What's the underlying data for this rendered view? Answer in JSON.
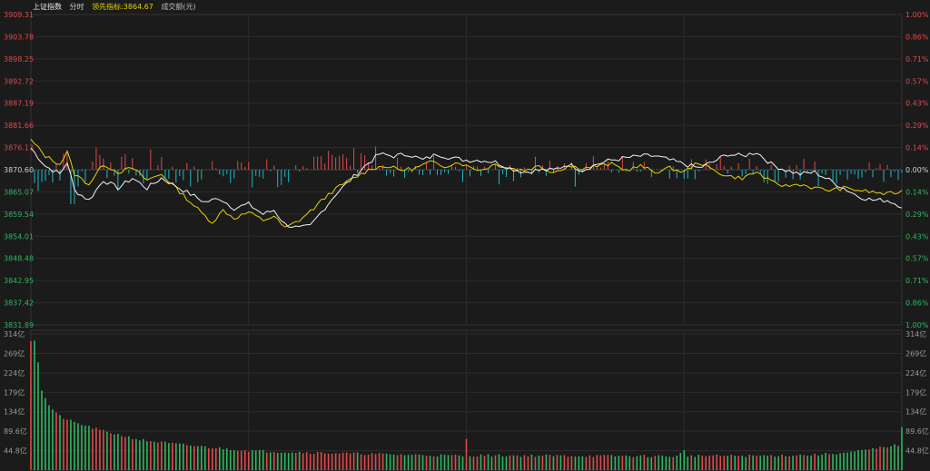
{
  "header": {
    "index_name": "上证指数",
    "period": "分时",
    "leading_label": "领先指标:",
    "leading_value": "3864.67",
    "volume_label": "成交额(元)"
  },
  "colors": {
    "up": "#e04a4a",
    "down": "#22b8c9",
    "price_line": "#f2f2f2",
    "lead_line": "#e6d200",
    "vol_up": "#e04a4a",
    "vol_down": "#2fb75e",
    "neutral": "#d0d0d0"
  },
  "chart_data": [
    {
      "type": "line",
      "title": "",
      "prev_close": 3870.6,
      "ylim": [
        3831.89,
        3909.31
      ],
      "y_ticks_left": [
        "3909.31",
        "3903.78",
        "3898.25",
        "3892.72",
        "3887.19",
        "3881.66",
        "3876.13",
        "3870.60",
        "3865.07",
        "3859.54",
        "3854.01",
        "3848.48",
        "3842.95",
        "3837.42",
        "3831.89"
      ],
      "y_ticks_right": [
        "1.00%",
        "0.86%",
        "0.71%",
        "0.57%",
        "0.43%",
        "0.29%",
        "0.14%",
        "0.00%",
        "0.14%",
        "0.29%",
        "0.43%",
        "0.57%",
        "0.71%",
        "0.86%",
        "1.00%"
      ],
      "grid": true,
      "x_count": 241,
      "series": [
        {
          "role": "price",
          "keys": [
            [
              0,
              3876.0
            ],
            [
              4,
              3871.5
            ],
            [
              8,
              3869.5
            ],
            [
              10,
              3872.5
            ],
            [
              12,
              3865.5
            ],
            [
              16,
              3863.0
            ],
            [
              20,
              3868.0
            ],
            [
              24,
              3866.0
            ],
            [
              28,
              3868.5
            ],
            [
              32,
              3866.0
            ],
            [
              36,
              3868.5
            ],
            [
              40,
              3866.5
            ],
            [
              44,
              3864.5
            ],
            [
              48,
              3862.5
            ],
            [
              52,
              3863.5
            ],
            [
              56,
              3861.0
            ],
            [
              60,
              3862.0
            ],
            [
              64,
              3859.5
            ],
            [
              67,
              3860.5
            ],
            [
              70,
              3857.0
            ],
            [
              74,
              3856.0
            ],
            [
              77,
              3856.5
            ],
            [
              80,
              3860.0
            ],
            [
              84,
              3864.5
            ],
            [
              88,
              3868.0
            ],
            [
              92,
              3871.5
            ],
            [
              96,
              3874.5
            ],
            [
              100,
              3874.0
            ],
            [
              104,
              3874.5
            ],
            [
              108,
              3873.0
            ],
            [
              112,
              3874.5
            ],
            [
              116,
              3873.5
            ],
            [
              120,
              3873.0
            ],
            [
              124,
              3873.0
            ],
            [
              128,
              3872.5
            ],
            [
              132,
              3871.0
            ],
            [
              136,
              3870.0
            ],
            [
              140,
              3870.5
            ],
            [
              144,
              3870.5
            ],
            [
              148,
              3872.0
            ],
            [
              152,
              3870.5
            ],
            [
              156,
              3872.0
            ],
            [
              160,
              3873.0
            ],
            [
              164,
              3873.5
            ],
            [
              168,
              3874.0
            ],
            [
              172,
              3874.0
            ],
            [
              176,
              3873.0
            ],
            [
              180,
              3872.0
            ],
            [
              184,
              3871.0
            ],
            [
              188,
              3872.5
            ],
            [
              192,
              3874.5
            ],
            [
              196,
              3874.0
            ],
            [
              200,
              3875.0
            ],
            [
              204,
              3872.0
            ],
            [
              208,
              3870.5
            ],
            [
              212,
              3869.5
            ],
            [
              216,
              3870.0
            ],
            [
              220,
              3868.0
            ],
            [
              224,
              3866.0
            ],
            [
              228,
              3864.0
            ],
            [
              232,
              3863.0
            ],
            [
              236,
              3863.0
            ],
            [
              240,
              3861.5
            ]
          ]
        },
        {
          "role": "leading",
          "keys": [
            [
              0,
              3878.0
            ],
            [
              4,
              3874.0
            ],
            [
              8,
              3872.0
            ],
            [
              10,
              3875.0
            ],
            [
              12,
              3869.5
            ],
            [
              16,
              3867.0
            ],
            [
              20,
              3872.0
            ],
            [
              24,
              3870.0
            ],
            [
              28,
              3871.0
            ],
            [
              32,
              3868.0
            ],
            [
              36,
              3869.5
            ],
            [
              40,
              3866.0
            ],
            [
              44,
              3862.5
            ],
            [
              48,
              3859.0
            ],
            [
              50,
              3857.5
            ],
            [
              53,
              3860.5
            ],
            [
              56,
              3858.5
            ],
            [
              60,
              3860.0
            ],
            [
              64,
              3858.0
            ],
            [
              67,
              3859.0
            ],
            [
              70,
              3856.0
            ],
            [
              74,
              3858.0
            ],
            [
              78,
              3861.0
            ],
            [
              82,
              3864.5
            ],
            [
              86,
              3867.0
            ],
            [
              90,
              3869.0
            ],
            [
              94,
              3871.0
            ],
            [
              98,
              3871.5
            ],
            [
              102,
              3870.5
            ],
            [
              106,
              3871.0
            ],
            [
              110,
              3872.5
            ],
            [
              114,
              3871.5
            ],
            [
              118,
              3872.5
            ],
            [
              120,
              3871.5
            ],
            [
              124,
              3870.5
            ],
            [
              128,
              3872.0
            ],
            [
              132,
              3871.0
            ],
            [
              136,
              3870.5
            ],
            [
              140,
              3871.5
            ],
            [
              144,
              3870.0
            ],
            [
              148,
              3871.5
            ],
            [
              152,
              3871.0
            ],
            [
              156,
              3871.5
            ],
            [
              160,
              3872.0
            ],
            [
              164,
              3870.5
            ],
            [
              168,
              3871.5
            ],
            [
              172,
              3870.0
            ],
            [
              176,
              3871.0
            ],
            [
              180,
              3870.0
            ],
            [
              184,
              3872.5
            ],
            [
              188,
              3870.5
            ],
            [
              192,
              3869.0
            ],
            [
              196,
              3868.5
            ],
            [
              200,
              3870.0
            ],
            [
              204,
              3867.5
            ],
            [
              208,
              3866.5
            ],
            [
              212,
              3867.0
            ],
            [
              216,
              3866.0
            ],
            [
              220,
              3865.5
            ],
            [
              224,
              3866.0
            ],
            [
              228,
              3865.5
            ],
            [
              232,
              3865.0
            ],
            [
              236,
              3864.5
            ],
            [
              240,
              3865.2
            ]
          ]
        }
      ]
    },
    {
      "type": "bar",
      "title": "",
      "ylim": [
        0,
        314
      ],
      "y_ticks": [
        "314亿",
        "269亿",
        "224亿",
        "179亿",
        "134亿",
        "89.6亿",
        "44.8亿"
      ],
      "grid": true,
      "x_count": 241,
      "volume_keys": [
        [
          0,
          300
        ],
        [
          1,
          300
        ],
        [
          2,
          250
        ],
        [
          3,
          185
        ],
        [
          4,
          165
        ],
        [
          5,
          150
        ],
        [
          6,
          140
        ],
        [
          7,
          130
        ],
        [
          9,
          120
        ],
        [
          12,
          110
        ],
        [
          16,
          100
        ],
        [
          20,
          90
        ],
        [
          25,
          80
        ],
        [
          30,
          70
        ],
        [
          40,
          60
        ],
        [
          50,
          52
        ],
        [
          60,
          45
        ],
        [
          70,
          42
        ],
        [
          80,
          40
        ],
        [
          100,
          36
        ],
        [
          119,
          33
        ],
        [
          120,
          70
        ],
        [
          121,
          34
        ],
        [
          150,
          33
        ],
        [
          178,
          32
        ],
        [
          180,
          44
        ],
        [
          181,
          33
        ],
        [
          200,
          33
        ],
        [
          215,
          35
        ],
        [
          225,
          40
        ],
        [
          232,
          48
        ],
        [
          236,
          55
        ],
        [
          239,
          58
        ],
        [
          240,
          100
        ]
      ]
    }
  ]
}
